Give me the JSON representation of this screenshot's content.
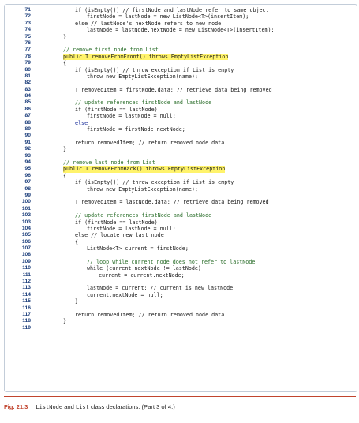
{
  "lines": [
    {
      "n": "71",
      "indent": 2,
      "text": "if (isEmpty()) // firstNode and lastNode refer to same object",
      "style": "code"
    },
    {
      "n": "72",
      "indent": 3,
      "text": "firstNode = lastNode = new ListNode<T>(insertItem);",
      "style": "code"
    },
    {
      "n": "73",
      "indent": 2,
      "text": "else // lastNode's nextNode refers to new node",
      "style": "code"
    },
    {
      "n": "74",
      "indent": 3,
      "text": "lastNode = lastNode.nextNode = new ListNode<T>(insertItem);",
      "style": "code"
    },
    {
      "n": "75",
      "indent": 1,
      "text": "}",
      "style": "code"
    },
    {
      "n": "76",
      "indent": 0,
      "text": "",
      "style": "code"
    },
    {
      "n": "77",
      "indent": 1,
      "text": "// remove first node from List",
      "style": "comment"
    },
    {
      "n": "78",
      "indent": 1,
      "text": "public T removeFromFront() throws EmptyListException",
      "style": "highlight"
    },
    {
      "n": "79",
      "indent": 1,
      "text": "{",
      "style": "code"
    },
    {
      "n": "80",
      "indent": 2,
      "text": "if (isEmpty()) // throw exception if List is empty",
      "style": "code"
    },
    {
      "n": "81",
      "indent": 3,
      "text": "throw new EmptyListException(name);",
      "style": "code"
    },
    {
      "n": "82",
      "indent": 0,
      "text": "",
      "style": "code"
    },
    {
      "n": "83",
      "indent": 2,
      "text": "T removedItem = firstNode.data; // retrieve data being removed",
      "style": "code"
    },
    {
      "n": "84",
      "indent": 0,
      "text": "",
      "style": "code"
    },
    {
      "n": "85",
      "indent": 2,
      "text": "// update references firstNode and lastNode",
      "style": "comment"
    },
    {
      "n": "86",
      "indent": 2,
      "text": "if (firstNode == lastNode)",
      "style": "code"
    },
    {
      "n": "87",
      "indent": 3,
      "text": "firstNode = lastNode = null;",
      "style": "code"
    },
    {
      "n": "88",
      "indent": 2,
      "text": "else",
      "style": "kw"
    },
    {
      "n": "89",
      "indent": 3,
      "text": "firstNode = firstNode.nextNode;",
      "style": "code"
    },
    {
      "n": "90",
      "indent": 0,
      "text": "",
      "style": "code"
    },
    {
      "n": "91",
      "indent": 2,
      "text": "return removedItem; // return removed node data",
      "style": "code"
    },
    {
      "n": "92",
      "indent": 1,
      "text": "}",
      "style": "code"
    },
    {
      "n": "93",
      "indent": 0,
      "text": "",
      "style": "code"
    },
    {
      "n": "94",
      "indent": 1,
      "text": "// remove last node from List",
      "style": "comment"
    },
    {
      "n": "95",
      "indent": 1,
      "text": "public T removeFromBack() throws EmptyListException",
      "style": "highlight"
    },
    {
      "n": "96",
      "indent": 1,
      "text": "{",
      "style": "code"
    },
    {
      "n": "97",
      "indent": 2,
      "text": "if (isEmpty()) // throw exception if List is empty",
      "style": "code"
    },
    {
      "n": "98",
      "indent": 3,
      "text": "throw new EmptyListException(name);",
      "style": "code"
    },
    {
      "n": "99",
      "indent": 0,
      "text": "",
      "style": "code"
    },
    {
      "n": "100",
      "indent": 2,
      "text": "T removedItem = lastNode.data; // retrieve data being removed",
      "style": "code"
    },
    {
      "n": "101",
      "indent": 0,
      "text": "",
      "style": "code"
    },
    {
      "n": "102",
      "indent": 2,
      "text": "// update references firstNode and lastNode",
      "style": "comment"
    },
    {
      "n": "103",
      "indent": 2,
      "text": "if (firstNode == lastNode)",
      "style": "code"
    },
    {
      "n": "104",
      "indent": 3,
      "text": "firstNode = lastNode = null;",
      "style": "code"
    },
    {
      "n": "105",
      "indent": 2,
      "text": "else // locate new last node",
      "style": "code"
    },
    {
      "n": "106",
      "indent": 2,
      "text": "{",
      "style": "code"
    },
    {
      "n": "107",
      "indent": 3,
      "text": "ListNode<T> current = firstNode;",
      "style": "code"
    },
    {
      "n": "108",
      "indent": 0,
      "text": "",
      "style": "code"
    },
    {
      "n": "109",
      "indent": 3,
      "text": "// loop while current node does not refer to lastNode",
      "style": "comment"
    },
    {
      "n": "110",
      "indent": 3,
      "text": "while (current.nextNode != lastNode)",
      "style": "code"
    },
    {
      "n": "111",
      "indent": 4,
      "text": "current = current.nextNode;",
      "style": "code"
    },
    {
      "n": "112",
      "indent": 0,
      "text": "",
      "style": "code"
    },
    {
      "n": "113",
      "indent": 3,
      "text": "lastNode = current; // current is new lastNode",
      "style": "code"
    },
    {
      "n": "114",
      "indent": 3,
      "text": "current.nextNode = null;",
      "style": "code"
    },
    {
      "n": "115",
      "indent": 2,
      "text": "}",
      "style": "code"
    },
    {
      "n": "116",
      "indent": 0,
      "text": "",
      "style": "code"
    },
    {
      "n": "117",
      "indent": 2,
      "text": "return removedItem; // return removed node data",
      "style": "code"
    },
    {
      "n": "118",
      "indent": 1,
      "text": "}",
      "style": "code"
    },
    {
      "n": "119",
      "indent": 0,
      "text": "",
      "style": "code"
    }
  ],
  "caption": {
    "fig": "Fig. 21.3",
    "class1": "ListNode",
    "and": " and ",
    "class2": "List",
    "rest": " class declarations. (Part 3 of 4.)"
  },
  "colors": {
    "highlight": "#fff36b",
    "line_number": "#1b3d7a",
    "fig_number": "#c1442e"
  }
}
